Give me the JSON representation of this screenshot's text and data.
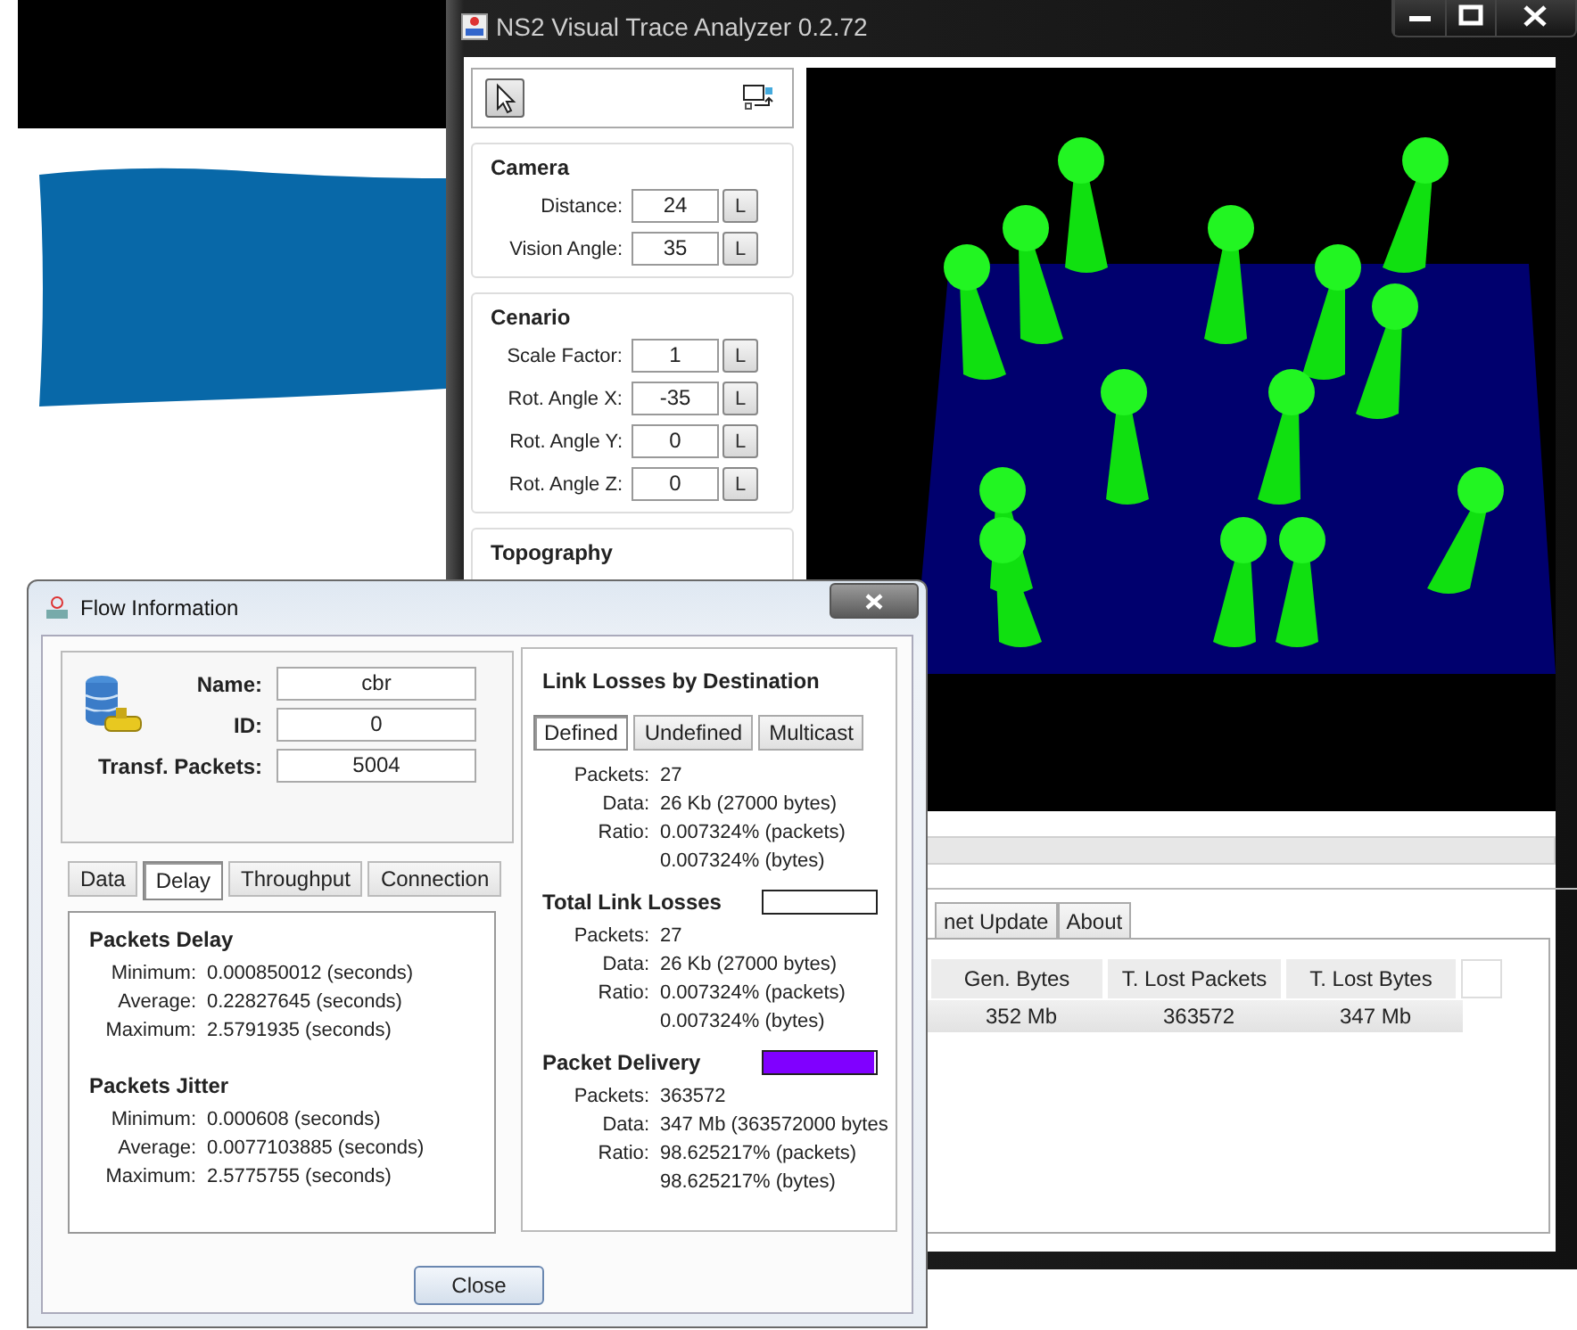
{
  "main_window": {
    "title": "NS2 Visual Trace Analyzer 0.2.72",
    "tools": [
      {
        "selected": true
      },
      {
        "selected": false
      }
    ],
    "groups": [
      {
        "title": "Camera",
        "fields": [
          {
            "label": "Distance:",
            "value": "24",
            "button": "L"
          },
          {
            "label": "Vision Angle:",
            "value": "35",
            "button": "L"
          }
        ]
      },
      {
        "title": "Cenario",
        "fields": [
          {
            "label": "Scale Factor:",
            "value": "1",
            "button": "L"
          },
          {
            "label": "Rot. Angle X:",
            "value": "-35",
            "button": "L"
          },
          {
            "label": "Rot. Angle Y:",
            "value": "0",
            "button": "L"
          },
          {
            "label": "Rot. Angle Z:",
            "value": "0",
            "button": "L"
          }
        ]
      },
      {
        "title": "Topography"
      }
    ],
    "tabs": [
      {
        "label": "net Update",
        "selected": false
      },
      {
        "label": "About",
        "selected": false
      }
    ],
    "table": {
      "columns": [
        "Gen. Bytes",
        "T. Lost Packets",
        "T. Lost Bytes"
      ],
      "rows": [
        [
          "352 Mb",
          "363572",
          "347 Mb"
        ]
      ]
    }
  },
  "flow_window": {
    "title": "Flow Information",
    "info": [
      {
        "label": "Name:",
        "value": "cbr"
      },
      {
        "label": "ID:",
        "value": "0"
      },
      {
        "label": "Transf. Packets:",
        "value": "5004"
      }
    ],
    "tabs": [
      {
        "label": "Data",
        "selected": false
      },
      {
        "label": "Delay",
        "selected": true
      },
      {
        "label": "Throughput",
        "selected": false
      },
      {
        "label": "Connection",
        "selected": false
      }
    ],
    "delay_sections": [
      {
        "title": "Packets Delay",
        "rows": [
          {
            "label": "Minimum:",
            "value": "0.000850012 (seconds)"
          },
          {
            "label": "Average:",
            "value": "0.22827645 (seconds)"
          },
          {
            "label": "Maximum:",
            "value": "2.5791935 (seconds)"
          }
        ]
      },
      {
        "title": "Packets Jitter",
        "rows": [
          {
            "label": "Minimum:",
            "value": "0.000608 (seconds)"
          },
          {
            "label": "Average:",
            "value": "0.0077103885 (seconds)"
          },
          {
            "label": "Maximum:",
            "value": "2.5775755 (seconds)"
          }
        ]
      }
    ],
    "link_losses": {
      "title": "Link Losses by Destination",
      "buttons": [
        {
          "label": "Defined",
          "selected": true
        },
        {
          "label": "Undefined",
          "selected": false
        },
        {
          "label": "Multicast",
          "selected": false
        }
      ],
      "rows": [
        {
          "label": "Packets:",
          "values": [
            "27"
          ]
        },
        {
          "label": "Data:",
          "values": [
            "26 Kb (27000 bytes)"
          ]
        },
        {
          "label": "Ratio:",
          "values": [
            "0.007324% (packets)",
            "0.007324% (bytes)"
          ]
        }
      ]
    },
    "summaries": [
      {
        "title": "Total Link Losses",
        "level": 0,
        "rows": [
          {
            "label": "Packets:",
            "values": [
              "27"
            ]
          },
          {
            "label": "Data:",
            "values": [
              "26 Kb (27000 bytes)"
            ]
          },
          {
            "label": "Ratio:",
            "values": [
              "0.007324% (packets)",
              "0.007324% (bytes)"
            ]
          }
        ]
      },
      {
        "title": "Packet Delivery",
        "level": 0.986,
        "rows": [
          {
            "label": "Packets:",
            "values": [
              "363572"
            ]
          },
          {
            "label": "Data:",
            "values": [
              "347 Mb (363572000 bytes"
            ]
          },
          {
            "label": "Ratio:",
            "values": [
              "98.625217% (packets)",
              "98.625217% (bytes)"
            ]
          }
        ]
      }
    ],
    "close_button": "Close"
  }
}
